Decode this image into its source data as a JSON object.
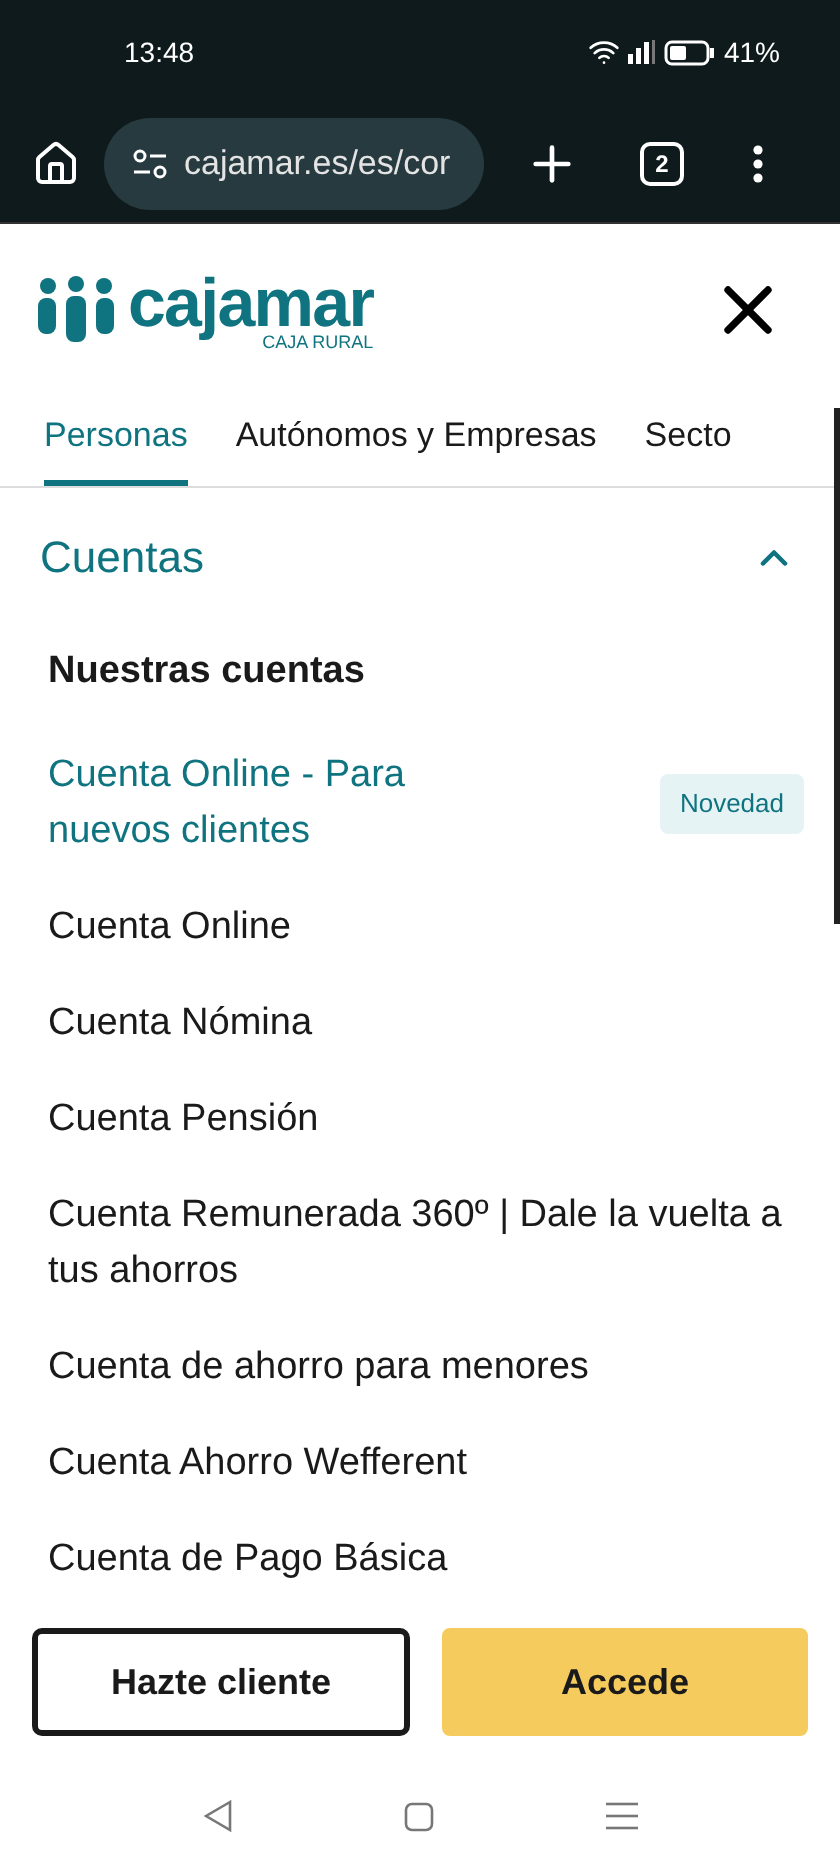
{
  "status_bar": {
    "time": "13:48",
    "battery": "41%"
  },
  "browser": {
    "url": "cajamar.es/es/cor",
    "tab_count": "2"
  },
  "header": {
    "logo_name": "cajamar",
    "logo_tagline": "CAJA RURAL"
  },
  "tabs": [
    {
      "label": "Personas",
      "selected": true
    },
    {
      "label": "Autónomos y Empresas",
      "selected": false
    },
    {
      "label": "Secto",
      "selected": false
    }
  ],
  "section": {
    "title": "Cuentas",
    "expanded": true
  },
  "menu": [
    {
      "kind": "heading",
      "label": "Nuestras cuentas"
    },
    {
      "kind": "link",
      "label": "Cuenta Online - Para nuevos clientes",
      "highlighted": true,
      "badge": "Novedad"
    },
    {
      "kind": "link",
      "label": "Cuenta Online",
      "highlighted": false
    },
    {
      "kind": "link",
      "label": "Cuenta Nómina",
      "highlighted": false
    },
    {
      "kind": "link",
      "label": "Cuenta Pensión",
      "highlighted": false
    },
    {
      "kind": "link",
      "label": "Cuenta Remunerada 360º | Dale la vuelta a tus ahorros",
      "highlighted": false
    },
    {
      "kind": "link",
      "label": "Cuenta de ahorro para menores",
      "highlighted": false
    },
    {
      "kind": "link",
      "label": "Cuenta Ahorro Wefferent",
      "highlighted": false
    },
    {
      "kind": "link",
      "label": "Cuenta de Pago Básica",
      "highlighted": false
    }
  ],
  "buttons": [
    {
      "kind": "outline",
      "label": "Hazte cliente"
    },
    {
      "kind": "filled",
      "label": "Accede"
    }
  ]
}
